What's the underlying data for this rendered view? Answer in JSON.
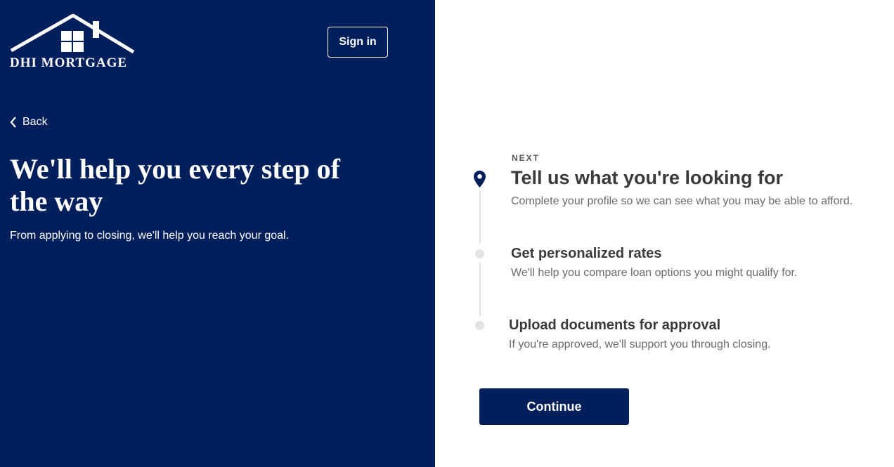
{
  "brand": {
    "logo_text": "DHI MORTGAGE",
    "primary_color": "#001f5b"
  },
  "header": {
    "signin_label": "Sign in"
  },
  "nav": {
    "back_label": "Back"
  },
  "hero": {
    "headline": "We'll help you every step of the way",
    "subline": "From applying to closing, we'll help you reach your goal."
  },
  "steps": {
    "current_marker": "NEXT",
    "items": [
      {
        "title": "Tell us what you're looking for",
        "description": "Complete your profile so we can see what you may be able to afford.",
        "icon": "location-pin-icon"
      },
      {
        "title": "Get personalized rates",
        "description": "We'll help you compare loan options you might qualify for.",
        "icon": "step-dot-icon"
      },
      {
        "title": "Upload documents for approval",
        "description": "If you're approved, we'll support you through closing.",
        "icon": "step-dot-icon"
      }
    ]
  },
  "actions": {
    "continue_label": "Continue"
  }
}
